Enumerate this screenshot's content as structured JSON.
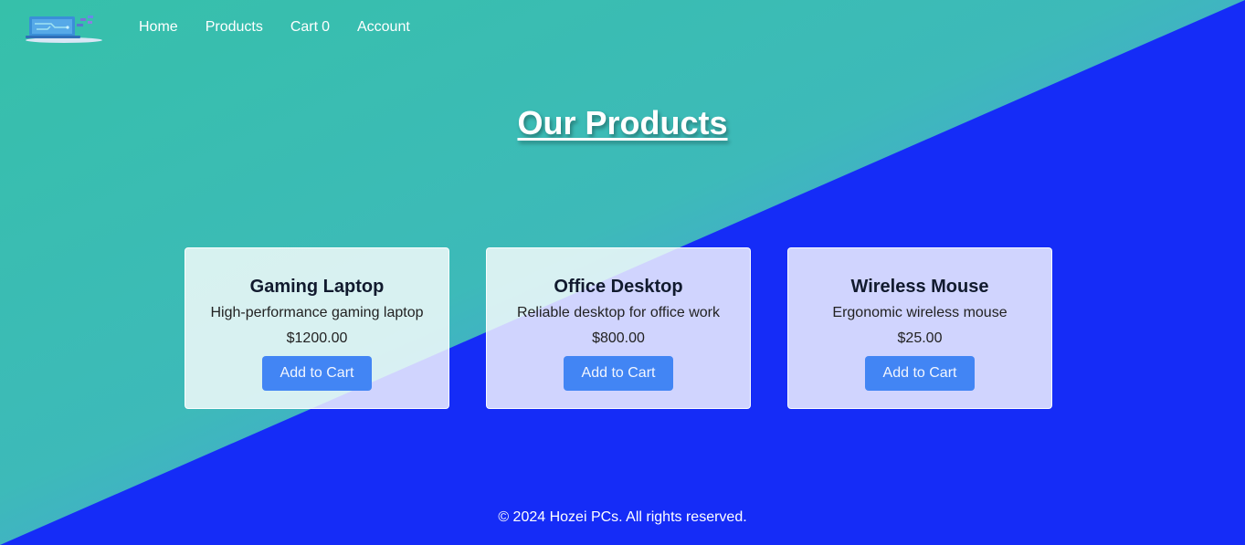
{
  "nav": {
    "items": [
      {
        "label": "Home"
      },
      {
        "label": "Products"
      },
      {
        "label": "Cart",
        "count": "0"
      },
      {
        "label": "Account"
      }
    ]
  },
  "page": {
    "title": "Our Products"
  },
  "products": [
    {
      "name": "Gaming Laptop",
      "description": "High-performance gaming laptop",
      "price": "$1200.00",
      "button_label": "Add to Cart"
    },
    {
      "name": "Office Desktop",
      "description": "Reliable desktop for office work",
      "price": "$800.00",
      "button_label": "Add to Cart"
    },
    {
      "name": "Wireless Mouse",
      "description": "Ergonomic wireless mouse",
      "price": "$25.00",
      "button_label": "Add to Cart"
    }
  ],
  "footer": {
    "text": "© 2024 Hozei PCs. All rights reserved."
  },
  "colors": {
    "gradient_start": "#36c0aa",
    "gradient_mid": "#4f92ee",
    "background_blue": "#152cf7",
    "button": "#4285f4"
  },
  "icons": {
    "logo": "laptop-circuit-logo"
  }
}
